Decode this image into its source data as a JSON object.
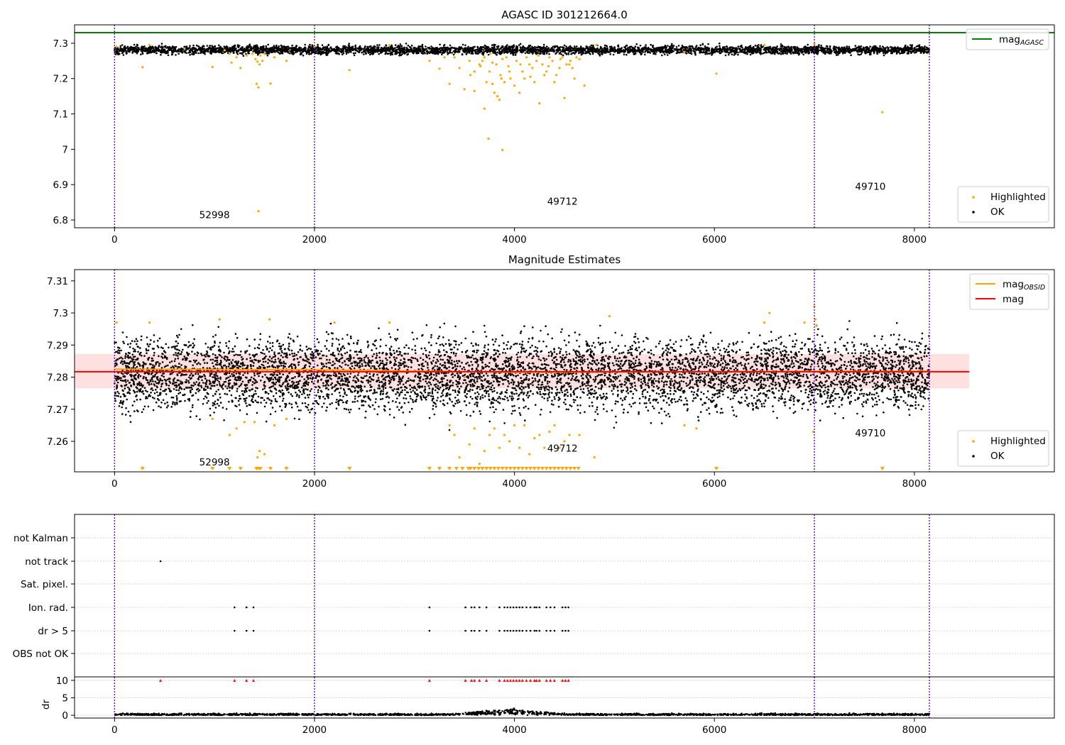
{
  "chart_data": [
    {
      "type": "scatter",
      "title": "AGASC ID 301212664.0",
      "xlabel": "",
      "ylabel": "",
      "xlim": [
        -400,
        9400
      ],
      "ylim": [
        6.778,
        7.352
      ],
      "xticks": [
        0,
        2000,
        4000,
        6000,
        8000
      ],
      "yticks": [
        6.8,
        6.9,
        7.0,
        7.1,
        7.2,
        7.3
      ],
      "grid": false,
      "hlines": [
        {
          "name": "mag_AGASC",
          "label": "mag",
          "sub": "AGASC",
          "y": 7.33,
          "color": "#008000"
        }
      ],
      "vlines": [
        0,
        2000,
        7000,
        8150
      ],
      "ok": {
        "name": "OK",
        "y_center": 7.281,
        "y_spread": 0.006,
        "x_range": [
          0,
          8150
        ],
        "color": "#000000"
      },
      "highlighted": {
        "name": "Highlighted",
        "color": "#ffa500",
        "points": [
          [
            20,
            7.29
          ],
          [
            280,
            7.232
          ],
          [
            350,
            7.295
          ],
          [
            700,
            7.285
          ],
          [
            980,
            7.233
          ],
          [
            1100,
            7.28
          ],
          [
            1150,
            7.27
          ],
          [
            1170,
            7.245
          ],
          [
            1220,
            7.26
          ],
          [
            1260,
            7.23
          ],
          [
            1320,
            7.265
          ],
          [
            1380,
            7.27
          ],
          [
            1410,
            7.255
          ],
          [
            1420,
            7.185
          ],
          [
            1430,
            7.248
          ],
          [
            1440,
            7.175
          ],
          [
            1450,
            7.24
          ],
          [
            1460,
            7.265
          ],
          [
            1480,
            7.25
          ],
          [
            1500,
            7.27
          ],
          [
            1560,
            7.186
          ],
          [
            1600,
            7.26
          ],
          [
            1720,
            7.25
          ],
          [
            2000,
            7.29
          ],
          [
            2350,
            7.224
          ],
          [
            2750,
            7.294
          ],
          [
            3150,
            7.25
          ],
          [
            3250,
            7.228
          ],
          [
            3300,
            7.26
          ],
          [
            3350,
            7.185
          ],
          [
            3400,
            7.26
          ],
          [
            3450,
            7.23
          ],
          [
            3500,
            7.17
          ],
          [
            3550,
            7.25
          ],
          [
            3600,
            7.165
          ],
          [
            3650,
            7.24
          ],
          [
            3700,
            7.115
          ],
          [
            3750,
            7.22
          ],
          [
            3780,
            7.185
          ],
          [
            3800,
            7.16
          ],
          [
            3830,
            7.15
          ],
          [
            3850,
            7.14
          ],
          [
            3870,
            7.2
          ],
          [
            3900,
            7.19
          ],
          [
            3950,
            7.22
          ],
          [
            4000,
            7.18
          ],
          [
            4050,
            7.16
          ],
          [
            4100,
            7.2
          ],
          [
            4150,
            7.24
          ],
          [
            4200,
            7.19
          ],
          [
            4250,
            7.13
          ],
          [
            4300,
            7.21
          ],
          [
            4350,
            7.26
          ],
          [
            4400,
            7.19
          ],
          [
            4450,
            7.23
          ],
          [
            4500,
            7.145
          ],
          [
            4550,
            7.24
          ],
          [
            4600,
            7.2
          ],
          [
            4650,
            7.255
          ],
          [
            4700,
            7.18
          ],
          [
            4820,
            7.295
          ],
          [
            5700,
            7.275
          ],
          [
            6020,
            7.214
          ],
          [
            6500,
            7.295
          ],
          [
            7000,
            7.298
          ],
          [
            7680,
            7.105
          ],
          [
            3740,
            7.03
          ],
          [
            3880,
            6.998
          ],
          [
            1440,
            6.825
          ],
          [
            3600,
            7.22
          ],
          [
            3680,
            7.25
          ],
          [
            3720,
            7.19
          ],
          [
            3760,
            7.27
          ],
          [
            3820,
            7.24
          ],
          [
            3860,
            7.21
          ],
          [
            3920,
            7.26
          ],
          [
            3960,
            7.2
          ],
          [
            4020,
            7.25
          ],
          [
            4080,
            7.22
          ],
          [
            4120,
            7.26
          ],
          [
            4180,
            7.23
          ],
          [
            4220,
            7.25
          ],
          [
            4280,
            7.24
          ],
          [
            4320,
            7.22
          ],
          [
            4380,
            7.25
          ],
          [
            4420,
            7.21
          ],
          [
            4480,
            7.26
          ],
          [
            4520,
            7.24
          ],
          [
            4580,
            7.23
          ],
          [
            4620,
            7.26
          ],
          [
            3560,
            7.21
          ],
          [
            3660,
            7.235
          ],
          [
            3700,
            7.26
          ],
          [
            3780,
            7.245
          ],
          [
            3880,
            7.255
          ],
          [
            3940,
            7.235
          ],
          [
            4060,
            7.24
          ],
          [
            4160,
            7.205
          ],
          [
            4240,
            7.265
          ],
          [
            4340,
            7.235
          ],
          [
            4460,
            7.255
          ],
          [
            4560,
            7.25
          ]
        ]
      },
      "annotations": [
        {
          "text": "52998",
          "x": 1000,
          "y": 6.805
        },
        {
          "text": "49712",
          "x": 4480,
          "y": 6.843
        },
        {
          "text": "49710",
          "x": 7560,
          "y": 6.885
        }
      ],
      "legends": [
        {
          "position": "top-right",
          "entries": [
            {
              "label": "mag",
              "sub": "AGASC",
              "kind": "line",
              "color": "#008000"
            }
          ]
        },
        {
          "position": "lower-right",
          "entries": [
            {
              "label": "Highlighted",
              "kind": "dot",
              "color": "#ffa500"
            },
            {
              "label": "OK",
              "kind": "dot",
              "color": "#000000"
            }
          ]
        }
      ]
    },
    {
      "type": "scatter",
      "title": "Magnitude Estimates",
      "xlabel": "",
      "ylabel": "",
      "xlim": [
        -400,
        9400
      ],
      "ylim": [
        7.2505,
        7.3135
      ],
      "xticks": [
        0,
        2000,
        4000,
        6000,
        8000
      ],
      "yticks": [
        7.26,
        7.27,
        7.28,
        7.29,
        7.3,
        7.31
      ],
      "grid": false,
      "band": {
        "y_low": 7.2765,
        "y_high": 7.2872,
        "x_range": [
          -400,
          8550
        ],
        "color": "#ffe0e0"
      },
      "lines": [
        {
          "name": "mag_OBSID",
          "label": "mag",
          "sub": "OBSID",
          "color": "#ffa500",
          "segments": [
            [
              0,
              7.2825
            ],
            [
              2000,
              7.2823
            ],
            [
              4000,
              7.2815
            ],
            [
              7000,
              7.2818
            ],
            [
              8150,
              7.2818
            ]
          ]
        },
        {
          "name": "mag",
          "label": "mag",
          "color": "#ff0000",
          "segments": [
            [
              -400,
              7.2817
            ],
            [
              8550,
              7.2817
            ]
          ]
        }
      ],
      "vlines": [
        0,
        2000,
        7000,
        8150
      ],
      "ok": {
        "name": "OK",
        "y_center": 7.281,
        "y_spread": 0.0055,
        "x_range": [
          0,
          8150
        ],
        "color": "#000000"
      },
      "highlighted": {
        "name": "Highlighted",
        "color": "#ffa500",
        "points": [
          [
            20,
            7.297
          ],
          [
            350,
            7.297
          ],
          [
            980,
            7.267
          ],
          [
            1050,
            7.298
          ],
          [
            1150,
            7.262
          ],
          [
            1220,
            7.264
          ],
          [
            1300,
            7.266
          ],
          [
            1400,
            7.266
          ],
          [
            1430,
            7.255
          ],
          [
            1450,
            7.257
          ],
          [
            1500,
            7.256
          ],
          [
            1550,
            7.298
          ],
          [
            1600,
            7.265
          ],
          [
            1720,
            7.267
          ],
          [
            2200,
            7.297
          ],
          [
            2750,
            7.297
          ],
          [
            3350,
            7.265
          ],
          [
            3400,
            7.262
          ],
          [
            3450,
            7.255
          ],
          [
            3500,
            7.28
          ],
          [
            3550,
            7.259
          ],
          [
            3600,
            7.264
          ],
          [
            3650,
            7.253
          ],
          [
            3700,
            7.257
          ],
          [
            3750,
            7.262
          ],
          [
            3800,
            7.264
          ],
          [
            3850,
            7.258
          ],
          [
            3900,
            7.262
          ],
          [
            3950,
            7.26
          ],
          [
            4000,
            7.265
          ],
          [
            4050,
            7.258
          ],
          [
            4100,
            7.265
          ],
          [
            4150,
            7.256
          ],
          [
            4200,
            7.261
          ],
          [
            4250,
            7.262
          ],
          [
            4300,
            7.258
          ],
          [
            4350,
            7.263
          ],
          [
            4400,
            7.265
          ],
          [
            4450,
            7.258
          ],
          [
            4500,
            7.26
          ],
          [
            4550,
            7.262
          ],
          [
            4650,
            7.262
          ],
          [
            4800,
            7.255
          ],
          [
            4950,
            7.299
          ],
          [
            5700,
            7.265
          ],
          [
            5820,
            7.264
          ],
          [
            6500,
            7.297
          ],
          [
            6550,
            7.3
          ],
          [
            6900,
            7.297
          ],
          [
            7000,
            7.302
          ],
          [
            7010,
            7.298
          ],
          [
            7020,
            7.296
          ],
          [
            6990,
            7.263
          ]
        ]
      },
      "clipped_markers": {
        "y": 7.2513,
        "x": [
          280,
          980,
          1150,
          1260,
          1420,
          1440,
          1460,
          1560,
          1720,
          2350,
          3150,
          3250,
          3350,
          3420,
          3480,
          3540,
          3560,
          3600,
          3640,
          3680,
          3720,
          3760,
          3800,
          3840,
          3880,
          3920,
          3960,
          4000,
          4040,
          4080,
          4120,
          4160,
          4200,
          4240,
          4280,
          4320,
          4360,
          4400,
          4440,
          4480,
          4520,
          4560,
          4600,
          4640,
          6020,
          7680
        ]
      },
      "annotations": [
        {
          "text": "52998",
          "x": 1000,
          "y": 7.2525
        },
        {
          "text": "49712",
          "x": 4480,
          "y": 7.2568
        },
        {
          "text": "49710",
          "x": 7560,
          "y": 7.2615
        }
      ],
      "legends": [
        {
          "position": "top-right",
          "entries": [
            {
              "label": "mag",
              "sub": "OBSID",
              "kind": "line",
              "color": "#ffa500"
            },
            {
              "label": "mag",
              "kind": "line",
              "color": "#ff0000"
            }
          ]
        },
        {
          "position": "lower-right",
          "entries": [
            {
              "label": "Highlighted",
              "kind": "dot",
              "color": "#ffa500"
            },
            {
              "label": "OK",
              "kind": "dot",
              "color": "#000000"
            }
          ]
        }
      ]
    },
    {
      "type": "scatter",
      "title": "",
      "xlabel": "",
      "ylabel": "",
      "xlim": [
        -400,
        9400
      ],
      "categories": [
        "not Kalman",
        "not track",
        "Sat. pixel.",
        "Ion. rad.",
        "dr > 5",
        "OBS not OK"
      ],
      "grid": true,
      "vlines": [
        0,
        2000,
        7000,
        8150
      ],
      "flags": {
        "not track": [
          460
        ],
        "Ion. rad.": [
          1200,
          1320,
          1390,
          3150,
          3510,
          3570,
          3600,
          3650,
          3720,
          3850,
          3900,
          3930,
          3960,
          3990,
          4020,
          4050,
          4080,
          4120,
          4160,
          4200,
          4220,
          4250,
          4320,
          4360,
          4400,
          4480,
          4510,
          4540
        ],
        "dr > 5": [
          1200,
          1320,
          1390,
          3150,
          3510,
          3570,
          3600,
          3650,
          3720,
          3850,
          3900,
          3930,
          3960,
          3990,
          4020,
          4050,
          4080,
          4120,
          4160,
          4200,
          4220,
          4250,
          4320,
          4360,
          4400,
          4480,
          4510,
          4540
        ]
      }
    },
    {
      "type": "scatter",
      "title": "",
      "xlabel": "",
      "ylabel": "dr",
      "xlim": [
        -400,
        9400
      ],
      "ylim": [
        -0.8,
        11
      ],
      "yticks": [
        0,
        5,
        10
      ],
      "grid": true,
      "vlines": [
        0,
        2000,
        7000,
        8150
      ],
      "clipped_markers": {
        "y": 10,
        "color": "#ff0000",
        "x": [
          460,
          1200,
          1320,
          1390,
          3150,
          3510,
          3570,
          3600,
          3650,
          3720,
          3850,
          3900,
          3930,
          3960,
          3990,
          4020,
          4050,
          4080,
          4120,
          4160,
          4200,
          4220,
          4250,
          4320,
          4360,
          4400,
          4480,
          4510,
          4540
        ]
      },
      "ok": {
        "name": "OK",
        "y_center": 0.2,
        "y_spread": 0.15,
        "x_range": [
          0,
          8150
        ],
        "color": "#000000"
      },
      "bump": {
        "x_center": 3950,
        "x_halfwidth": 600,
        "max": 1.6
      }
    }
  ]
}
